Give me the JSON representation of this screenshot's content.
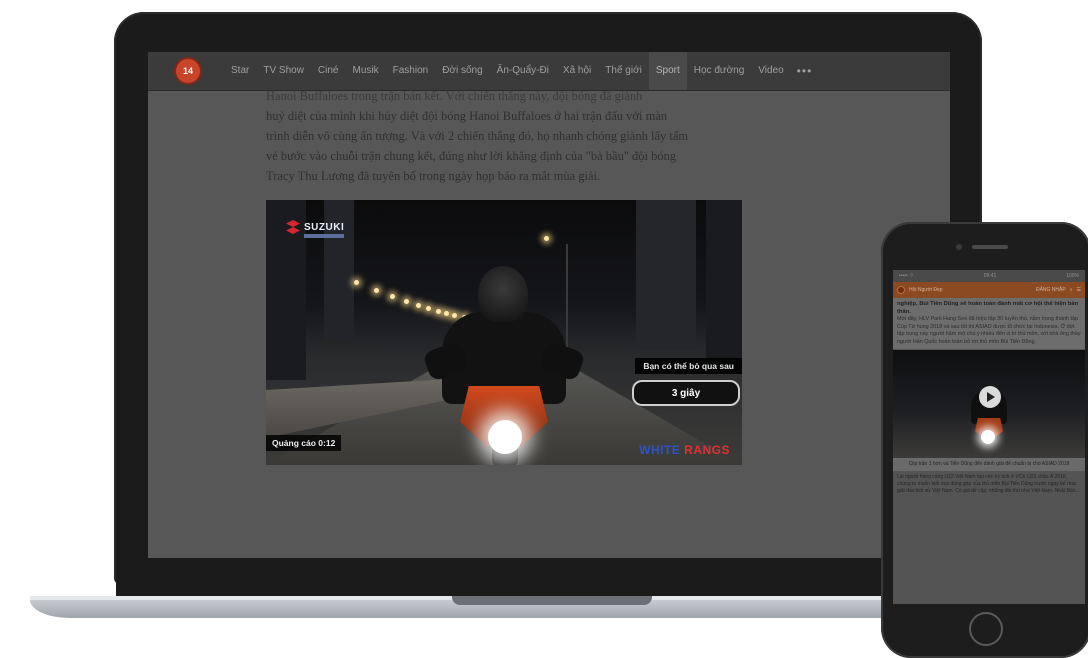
{
  "laptop": {
    "nav": {
      "logo_text": "14",
      "items": [
        "Star",
        "TV Show",
        "Ciné",
        "Musik",
        "Fashion",
        "Đời sống",
        "Ăn-Quẩy-Đi",
        "Xã hội",
        "Thế giới",
        "Sport",
        "Học đường",
        "Video"
      ],
      "active_index": 9,
      "more": "•••"
    },
    "article_lines": [
      "Hanoi Buffaloes trong trận bán kết. Với chiến thắng này, đội bóng đã giành",
      "huỷ diệt của mình khi hủy diệt đội bóng Hanoi Buffaloes ở hai trận đấu với màn",
      "trình diễn vô cùng ấn tượng. Và với 2 chiến thắng đó, họ nhanh chóng giành lấy tấm",
      "vé bước vào chuỗi trận chung kết, đúng như lời khẳng định của \"bà bầu\" đội bóng",
      "Tracy Thu Lương đã tuyên bố trong ngày họp báo ra mắt mùa giải."
    ],
    "video": {
      "brand": "SUZUKI",
      "skip_prompt": "Bạn có thể bỏ qua sau",
      "skip_countdown": "3 giây",
      "ad_counter": "Quảng cáo 0:12",
      "ad_brand_a": "WHITE",
      "ad_brand_b": "RANGS"
    }
  },
  "phone": {
    "status_left": "••••• ⌔",
    "status_center": "09:41",
    "status_right": "100%",
    "header_left": "Hội Người Đẹp",
    "header_right": "ĐĂNG NHẬP",
    "article_title": "nghiệp, Bùi Tiến Dũng sẽ hoàn toàn đánh mất cơ hội thể hiện bản thân.",
    "article_text": "Mới đây, HLV Park Hang Seo đã triệu tập 30 tuyển thủ, nằm trong thành tập Cúp Tứ hùng 2018 và sau tốt thi ASIAD được tổ chức tại Indonesia. Ở đợt tập trung này người hâm mộ chú ý nhiều đến vị trí thủ môn, với nhà ông thầy người Hàn Quốc hoàn toàn bỏ rơi thủ môn Bùi Tiến Dũng.",
    "video_caption": "Clip trận 1 hơn và Tiến Dũng đến dành giải để chuẩn bị cho ASIAD 2018",
    "body_text": "Lại người hùng cùng U23 Việt Nam tạo nên kỳ tích ở VCK U23 châu Á 2018, chúng ta muốn biết mọi đóng góp của thủ môn Bùi Tiến Dũng trước ngày bế mạc giải đấu lịch sử Việt Nam. Có giả đề cập, những đối thủ như Việt Nam, Nhật Bản..."
  }
}
